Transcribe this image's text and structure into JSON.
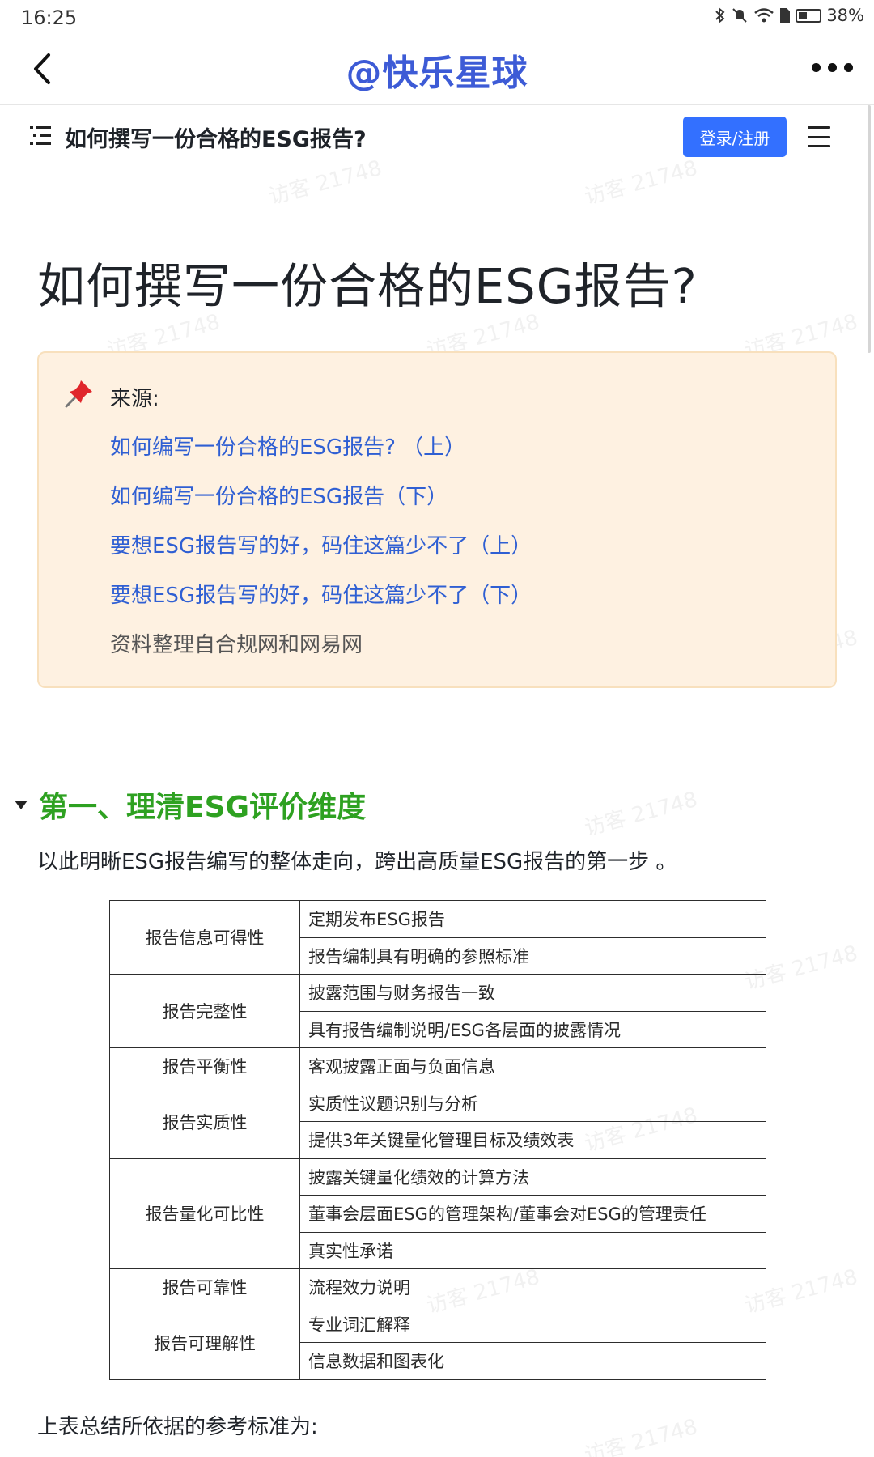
{
  "status_bar": {
    "time": "16:25",
    "battery": "38%",
    "icons": [
      "bluetooth-icon",
      "mute-icon",
      "wifi-icon",
      "sim-icon",
      "battery-icon"
    ]
  },
  "nav": {
    "title": "@快乐星球",
    "back_icon": "chevron-left-icon",
    "more_icon": "more-dots-icon"
  },
  "doc_bar": {
    "title": "如何撰写一份合格的ESG报告?",
    "login_label": "登录/注册",
    "toc_icon": "toc-icon",
    "menu_icon": "hamburger-menu-icon"
  },
  "watermark_text": "访客 21748",
  "page_title": "如何撰写一份合格的ESG报告?",
  "callout": {
    "icon": "pushpin-icon",
    "label": "来源:",
    "links": [
      "如何编写一份合格的ESG报告? （上）",
      "如何编写一份合格的ESG报告（下）",
      "要想ESG报告写的好，码住这篇少不了（上）",
      "要想ESG报告写的好，码住这篇少不了（下）"
    ],
    "note": "资料整理自合规网和网易网",
    "colors": {
      "background": "#fef1e1",
      "border": "#f8e0bd",
      "link": "#2f5fd3"
    }
  },
  "section": {
    "title": "第一、理清ESG评价维度",
    "color": "#2ea121",
    "intro": "以此明晰ESG报告编写的整体走向，跨出高质量ESG报告的第一步 。"
  },
  "table": {
    "rows": [
      {
        "dimension": "报告信息可得性",
        "items": [
          "定期发布ESG报告",
          "报告编制具有明确的参照标准"
        ]
      },
      {
        "dimension": "报告完整性",
        "items": [
          "披露范围与财务报告一致",
          "具有报告编制说明/ESG各层面的披露情况"
        ]
      },
      {
        "dimension": "报告平衡性",
        "items": [
          "客观披露正面与负面信息"
        ]
      },
      {
        "dimension": "报告实质性",
        "items": [
          "实质性议题识别与分析",
          "提供3年关键量化管理目标及绩效表"
        ]
      },
      {
        "dimension": "报告量化可比性",
        "items": [
          "披露关键量化绩效的计算方法",
          "董事会层面ESG的管理架构/董事会对ESG的管理责任",
          "真实性承诺"
        ]
      },
      {
        "dimension": "报告可靠性",
        "items": [
          "流程效力说明"
        ]
      },
      {
        "dimension": "报告可理解性",
        "items": [
          "专业词汇解释",
          "信息数据和图表化"
        ]
      }
    ]
  },
  "footer_text": "上表总结所依据的参考标准为:",
  "accent_colors": {
    "login_button": "#3370ff",
    "nav_title": "#3d5bd6"
  }
}
